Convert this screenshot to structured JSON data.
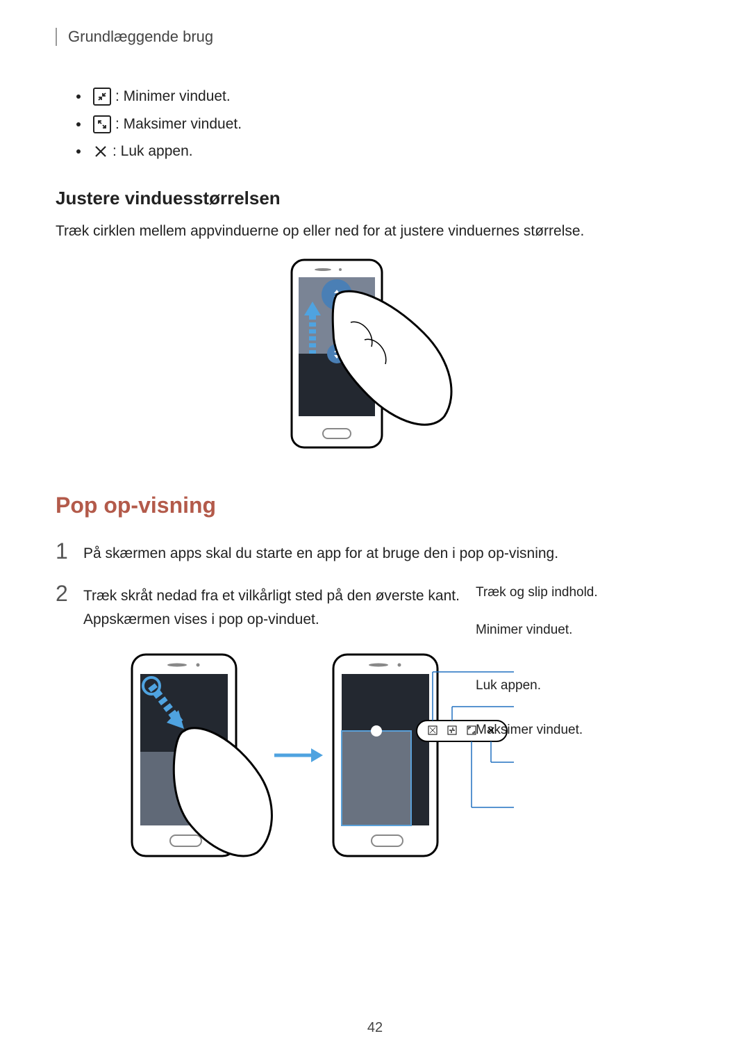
{
  "header": {
    "section_title": "Grundlæggende brug"
  },
  "icon_list": {
    "minimize": ": Minimer vinduet.",
    "maximize": ": Maksimer vinduet.",
    "close": ": Luk appen."
  },
  "subheading1": "Justere vinduesstørrelsen",
  "body1": "Træk cirklen mellem appvinduerne op eller ned for at justere vinduernes størrelse.",
  "accent_heading": "Pop op-visning",
  "steps": [
    {
      "num": "1",
      "text": "På skærmen apps skal du starte en app for at bruge den i pop op-visning."
    },
    {
      "num": "2",
      "text": "Træk skråt nedad fra et vilkårligt sted på den øverste kant.\nAppskærmen vises i pop op-vinduet."
    }
  ],
  "callouts": {
    "drag": "Træk og slip indhold.",
    "min": "Minimer vinduet.",
    "close": "Luk appen.",
    "max": "Maksimer vinduet."
  },
  "page_number": "42"
}
